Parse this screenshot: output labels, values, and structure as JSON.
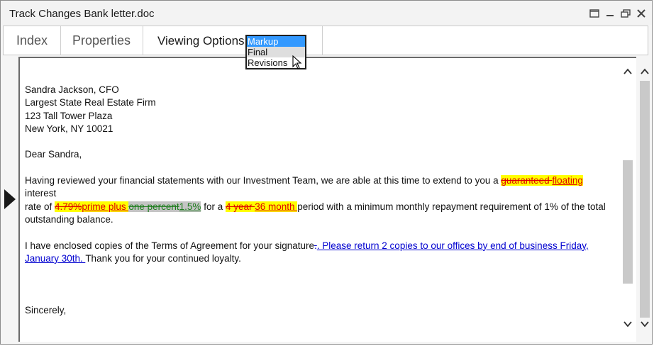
{
  "window": {
    "title": "Track Changes Bank letter.doc"
  },
  "tabs": {
    "index": "Index",
    "properties": "Properties",
    "viewing_label": "Viewing Options:",
    "options": [
      "Markup",
      "Final",
      "Revisions"
    ],
    "selected_option": "Markup"
  },
  "letter": {
    "address": [
      "Sandra Jackson, CFO",
      "Largest State Real Estate Firm",
      "123 Tall Tower Plaza",
      "New York, NY 10021"
    ],
    "greeting": "Dear Sandra,",
    "p1": {
      "t1": "Having reviewed your financial statements with our Investment Team, we are able at this time to extend to you a ",
      "del1": "guaranteed ",
      "ins1": "floating ",
      "t2": "interest",
      "t3": "rate of ",
      "del2": "4.79%",
      "ins2": "prime plus ",
      "del3": "one percent",
      "ins3": "1.5%",
      "t4": " for a ",
      "del4": "4 year ",
      "ins4": "36 month ",
      "t5": "period with a minimum monthly repayment requirement of 1% of the total",
      "t6": "outstanding balance."
    },
    "p2": {
      "t1": "I have enclosed copies of the Terms of Agreement for your signature",
      "del1": ".",
      "ins1": ". Please return 2 copies to our offices by end of business Friday,",
      "ins2": "January 30th. ",
      "t2": "Thank you for your continued loyalty."
    },
    "closing": "Sincerely,"
  },
  "colors": {
    "deletion": "#e00000",
    "insertion_green": "#1e7d1e",
    "insertion_blue": "#0000d0",
    "highlight_yellow": "#ffff00",
    "highlight_gray": "#c4c4c4",
    "dropdown_selected": "#3399ff"
  },
  "icons": [
    "restore-icon",
    "minimize-icon",
    "maximize-icon",
    "close-icon",
    "scroll-up-icon",
    "scroll-down-icon",
    "pointer-cursor-icon",
    "current-line-arrow-icon"
  ]
}
